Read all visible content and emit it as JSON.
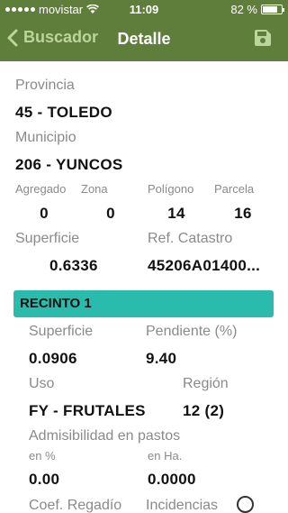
{
  "status": {
    "carrier": "movistar",
    "time": "11:09",
    "battery": "82 %"
  },
  "nav": {
    "back": "Buscador",
    "title": "Detalle"
  },
  "detail": {
    "provincia_label": "Provincia",
    "provincia_value": "45 - TOLEDO",
    "municipio_label": "Municipio",
    "municipio_value": "206 - YUNCOS",
    "agregado_label": "Agregado",
    "agregado_value": "0",
    "zona_label": "Zona",
    "zona_value": "0",
    "poligono_label": "Polígono",
    "poligono_value": "14",
    "parcela_label": "Parcela",
    "parcela_value": "16",
    "superficie_label": "Superficie",
    "superficie_value": "0.6336",
    "catastro_label": "Ref. Catastro",
    "catastro_value": "45206A01400..."
  },
  "recinto": {
    "header": "RECINTO 1",
    "superficie_label": "Superficie",
    "superficie_value": "0.0906",
    "pendiente_label": "Pendiente (%)",
    "pendiente_value": "9.40",
    "uso_label": "Uso",
    "uso_value": "FY - FRUTALES",
    "region_label": "Región",
    "region_value": "12 (2)",
    "admisibilidad_label": "Admisibilidad en pastos",
    "porcentaje_label": "en %",
    "porcentaje_value": "0.00",
    "hectareas_label": "en Ha.",
    "hectareas_value": "0.0000",
    "coef_label": "Coef. Regadío",
    "incidencias_label": "Incidencias"
  },
  "colors": {
    "bar": "#5f7d3b",
    "back": "#bcd59a",
    "recinto": "#2bbbad"
  },
  "icons": [
    "wifi-icon",
    "chevron-left-icon",
    "save-icon",
    "info-icon"
  ]
}
